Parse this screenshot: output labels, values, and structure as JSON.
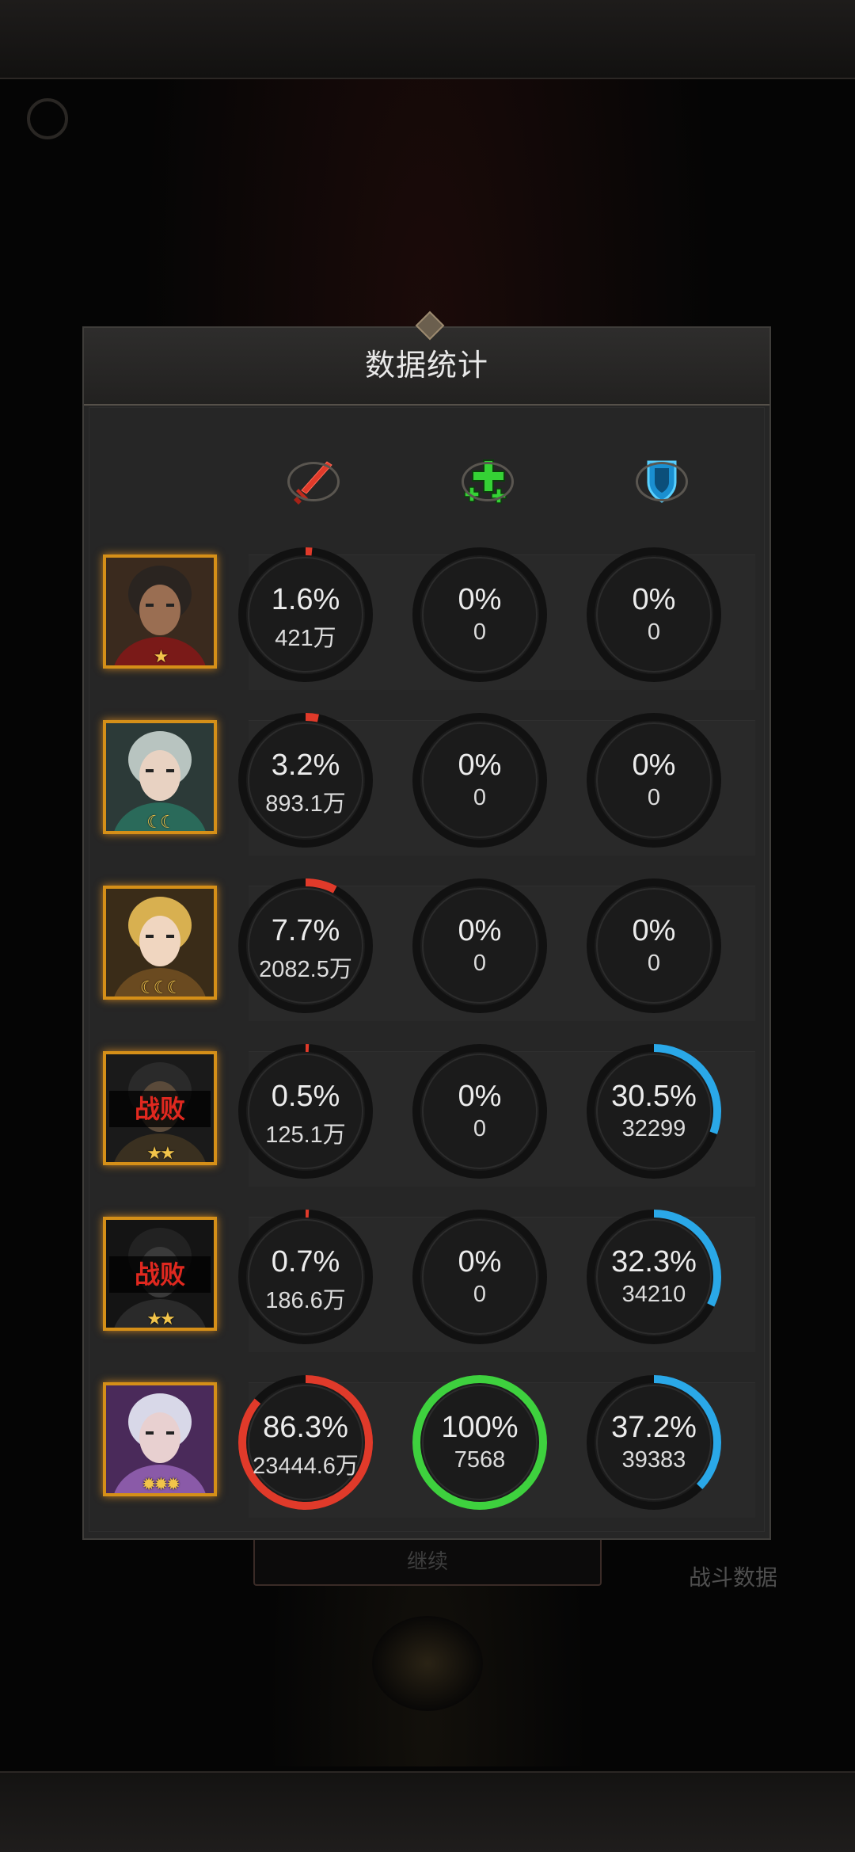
{
  "panel": {
    "title": "数据统计"
  },
  "columns": [
    {
      "icon": "red-sword-damage-icon",
      "color": "#e03a2a"
    },
    {
      "icon": "green-plus-heal-icon",
      "color": "#3ed13e"
    },
    {
      "icon": "blue-shield-tank-icon",
      "color": "#2aa8e8"
    }
  ],
  "background": {
    "battle_data_label": "战斗数据",
    "button_label": "继续"
  },
  "defeat_label": "战败",
  "heroes": [
    {
      "name_icon": "bearded-warrior-portrait",
      "stars": "★",
      "defeated": false,
      "stats": [
        {
          "pct": "1.6%",
          "value": "421万",
          "fraction": 0.016
        },
        {
          "pct": "0%",
          "value": "0",
          "fraction": 0
        },
        {
          "pct": "0%",
          "value": "0",
          "fraction": 0
        }
      ]
    },
    {
      "name_icon": "silver-hair-woman-portrait",
      "stars": "☾☾",
      "defeated": false,
      "stats": [
        {
          "pct": "3.2%",
          "value": "893.1万",
          "fraction": 0.032
        },
        {
          "pct": "0%",
          "value": "0",
          "fraction": 0
        },
        {
          "pct": "0%",
          "value": "0",
          "fraction": 0
        }
      ]
    },
    {
      "name_icon": "blonde-woman-portrait",
      "stars": "☾☾☾",
      "defeated": false,
      "stats": [
        {
          "pct": "7.7%",
          "value": "2082.5万",
          "fraction": 0.077
        },
        {
          "pct": "0%",
          "value": "0",
          "fraction": 0
        },
        {
          "pct": "0%",
          "value": "0",
          "fraction": 0
        }
      ]
    },
    {
      "name_icon": "dark-hero-portrait",
      "stars": "★★",
      "defeated": true,
      "stats": [
        {
          "pct": "0.5%",
          "value": "125.1万",
          "fraction": 0.005
        },
        {
          "pct": "0%",
          "value": "0",
          "fraction": 0
        },
        {
          "pct": "30.5%",
          "value": "32299",
          "fraction": 0.305
        }
      ]
    },
    {
      "name_icon": "dark-beast-portrait",
      "stars": "★★",
      "defeated": true,
      "stats": [
        {
          "pct": "0.7%",
          "value": "186.6万",
          "fraction": 0.007
        },
        {
          "pct": "0%",
          "value": "0",
          "fraction": 0
        },
        {
          "pct": "32.3%",
          "value": "34210",
          "fraction": 0.323
        }
      ]
    },
    {
      "name_icon": "elf-priestess-portrait",
      "stars": "✹✹✹",
      "defeated": false,
      "stats": [
        {
          "pct": "86.3%",
          "value": "23444.6万",
          "fraction": 0.863
        },
        {
          "pct": "100%",
          "value": "7568",
          "fraction": 1.0
        },
        {
          "pct": "37.2%",
          "value": "39383",
          "fraction": 0.372
        }
      ]
    }
  ]
}
